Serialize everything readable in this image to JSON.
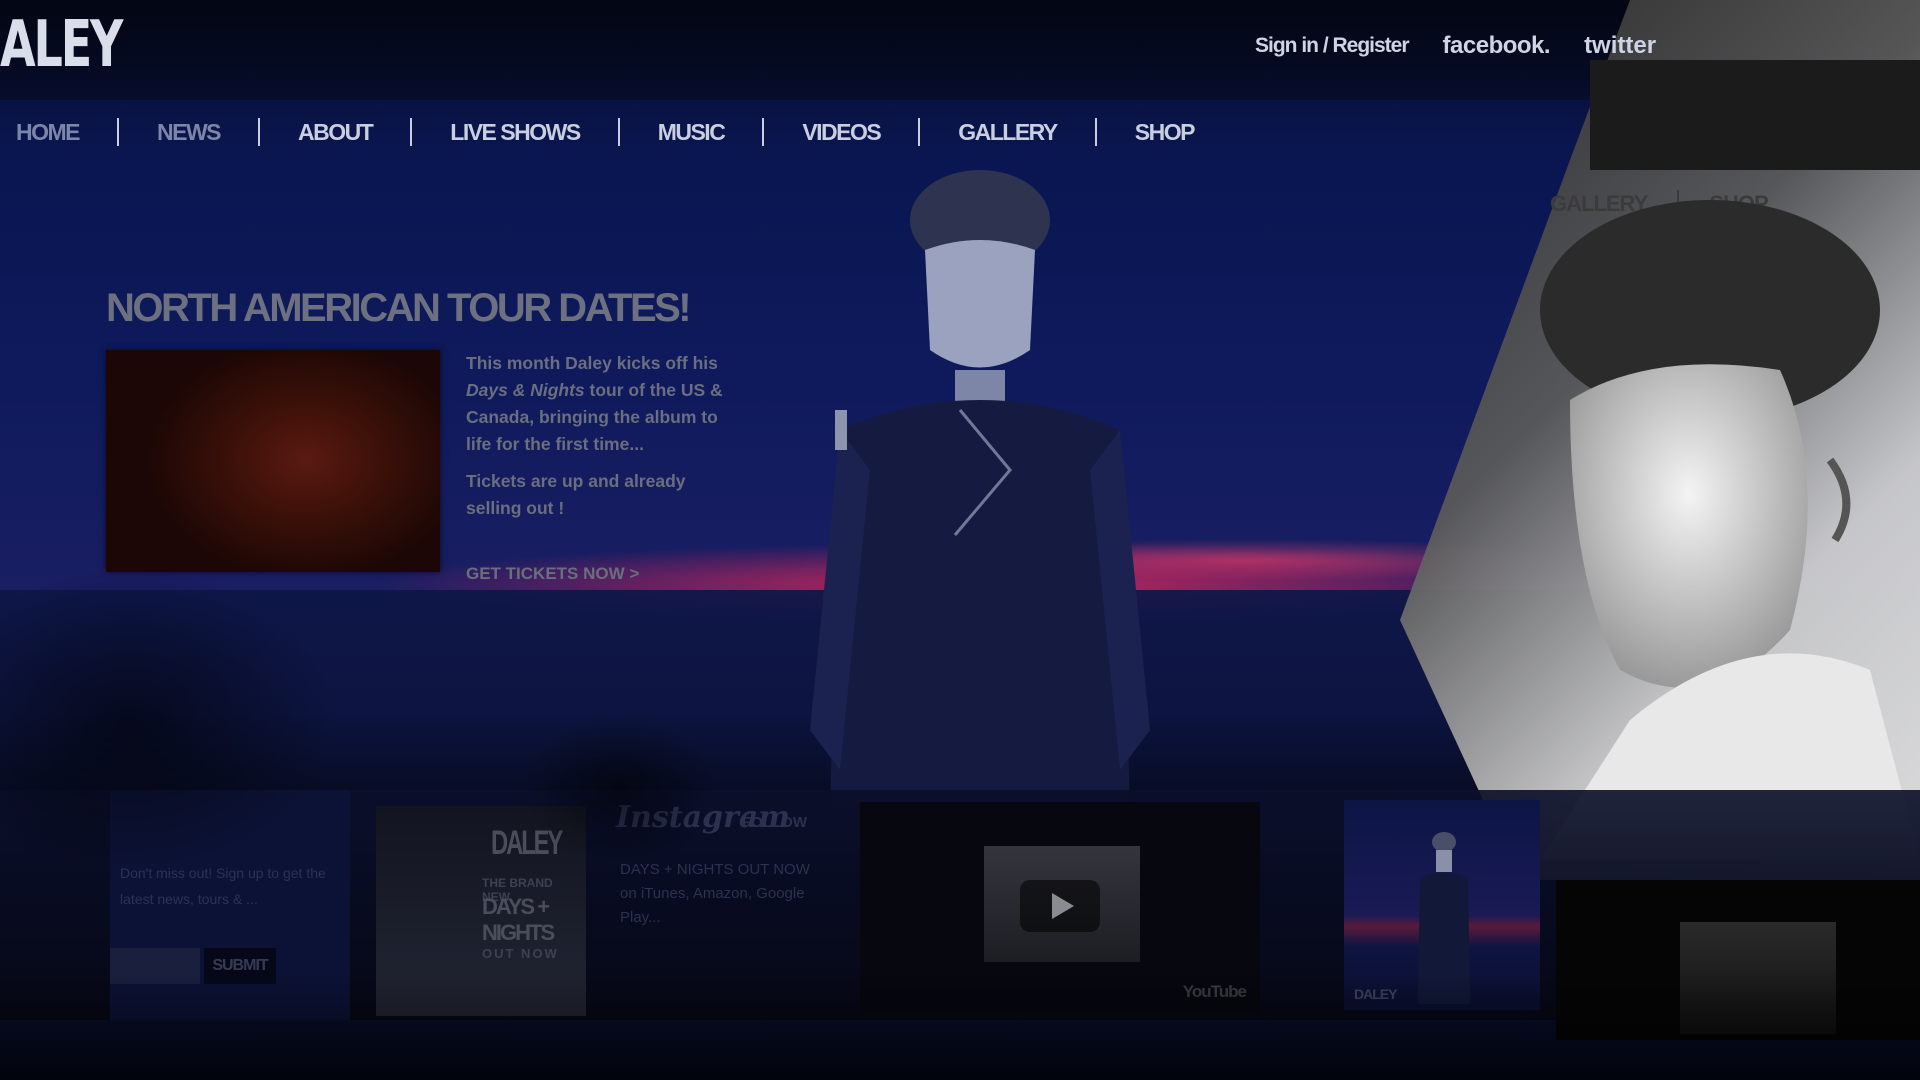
{
  "header": {
    "logo": "ALEY",
    "sign_in": "Sign in / Register",
    "facebook": "facebook.",
    "twitter": "twitter"
  },
  "nav": {
    "items": [
      "HOME",
      "NEWS",
      "ABOUT",
      "LIVE SHOWS",
      "MUSIC",
      "VIDEOS",
      "GALLERY",
      "SHOP"
    ]
  },
  "side_nav": {
    "items": [
      "GALLERY",
      "SHOP"
    ]
  },
  "hero": {
    "title": "NORTH AMERICAN TOUR DATES!",
    "text_before": "This month Daley kicks off his ",
    "text_em": "Days & Nights",
    "text_after": " tour of the US & Canada, bringing the album to life for the first time...",
    "tickets_text": "Tickets are up and already selling out !",
    "cta": "GET TICKETS NOW >"
  },
  "widgets": {
    "newsletter": {
      "text": "Don't miss out! Sign up to get the latest news, tours & ...",
      "submit": "SUBMIT"
    },
    "album": {
      "artist": "DALEY",
      "small": "THE BRAND NEW",
      "title": "DAYS + NIGHTS",
      "status": "OUT NOW"
    },
    "instagram": {
      "logo": "Instagram",
      "follow": "FOLLOW",
      "text": "DAYS + NIGHTS OUT NOW on iTunes, Amazon, Google Play..."
    },
    "video": {
      "brand": "YouTube"
    },
    "photo": {
      "label": "DALEY"
    }
  },
  "colors": {
    "accent_sky": "#0e1a5c",
    "sunset": "#ff285a",
    "panel_grey": "#cfcfcf"
  }
}
